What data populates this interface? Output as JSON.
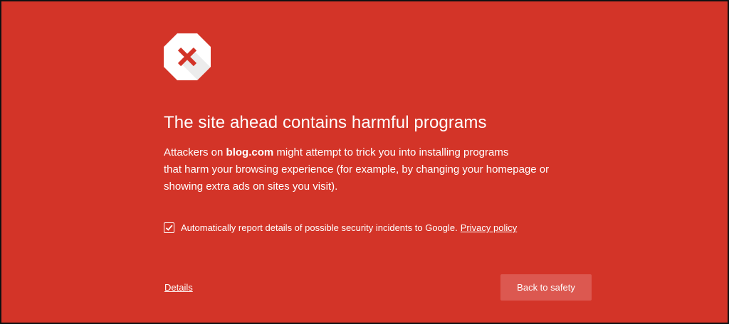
{
  "interstitial": {
    "heading": "The site ahead contains harmful programs",
    "explanation": {
      "before_domain": "Attackers on ",
      "domain": "blog.com",
      "line1_after": " might attempt to trick you into installing programs",
      "line2": "that harm your browsing experience (for example, by changing your homepage or",
      "line3": "showing extra ads on sites you visit)."
    },
    "report": {
      "checked": true,
      "label": "Automatically report details of possible security incidents to Google.",
      "privacy_link": "Privacy policy"
    },
    "details_link": "Details",
    "back_button": "Back to safety",
    "icon": "stop-sign-x-icon"
  },
  "colors": {
    "background": "#d33428",
    "button": "#dc5850",
    "text": "#ffffff"
  }
}
